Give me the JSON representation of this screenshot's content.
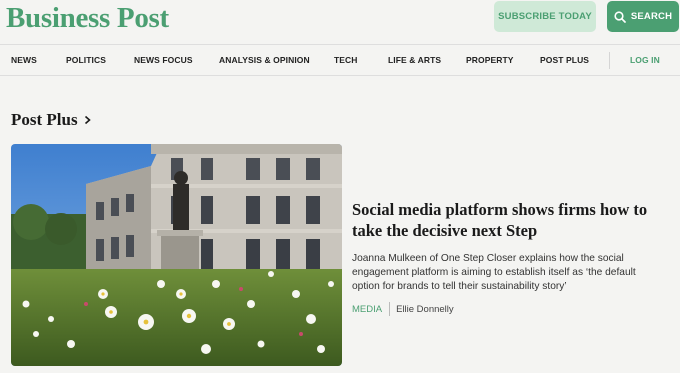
{
  "brand": {
    "name": "Business Post",
    "color": "#4b9f72"
  },
  "header": {
    "subscribe_label": "SUBSCRIBE TODAY",
    "search_label": "SEARCH"
  },
  "nav": {
    "items": [
      "NEWS",
      "POLITICS",
      "NEWS FOCUS",
      "ANALYSIS & OPINION",
      "TECH",
      "LIFE & ARTS",
      "PROPERTY",
      "POST PLUS"
    ],
    "login": "LOG IN"
  },
  "section": {
    "title": "Post Plus"
  },
  "article": {
    "headline": "Social media platform shows firms how to take the decisive next Step",
    "standfirst": "Joanna Mulkeen of One Step Closer explains how the social engagement platform is aiming to establish itself as ‘the default option for brands to tell their sustainability story’",
    "tag": "MEDIA",
    "author": "Ellie Donnelly"
  }
}
